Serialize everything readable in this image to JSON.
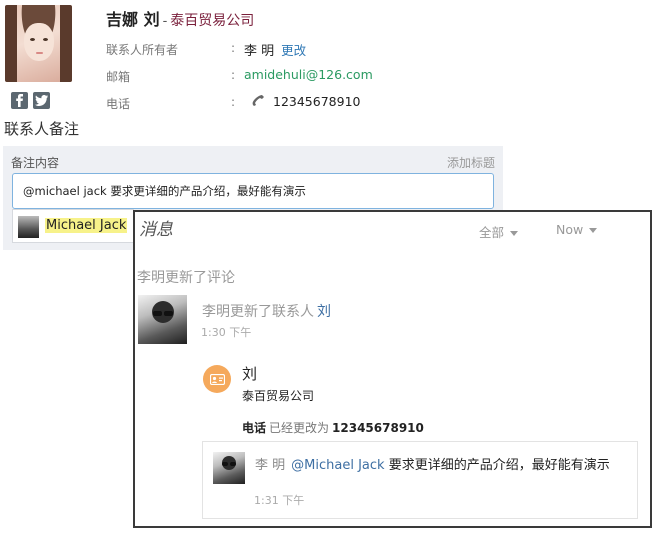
{
  "contact": {
    "name": "吉娜 刘",
    "separator": "-",
    "company": "泰百贸易公司",
    "avatar_icon": "user-photo",
    "social_icons": [
      "facebook-icon",
      "twitter-icon"
    ],
    "fields": {
      "owner_label": "联系人所有者",
      "owner_value": "李 明",
      "owner_change": "更改",
      "email_label": "邮箱",
      "email_value": "amidehuli@126.com",
      "phone_label": "电话",
      "phone_value": "12345678910",
      "colon": ":"
    }
  },
  "notes": {
    "section_title": "联系人备注",
    "content_label": "备注内容",
    "add_title": "添加标题",
    "input_value": "@michael jack 要求更详细的产品介绍，最好能有演示",
    "mention_suggestion": "Michael Jack"
  },
  "messages": {
    "title": "消息",
    "filter_all": "全部",
    "filter_time": "Now",
    "update_label": "李明更新了评论",
    "activity": {
      "text": "李明更新了联系人",
      "link": "刘",
      "time": "1:30 下午"
    },
    "card": {
      "name": "刘",
      "company": "泰百贸易公司",
      "phone_label": "电话",
      "phone_change": "已经更改为",
      "phone_value": "12345678910"
    },
    "comment": {
      "author": "李 明",
      "mention": "@Michael Jack",
      "text": "要求更详细的产品介绍，最好能有演示",
      "time": "1:31 下午"
    }
  },
  "colors": {
    "company": "#7a1f3b",
    "link": "#2f78b5",
    "email": "#2b9a62",
    "contact_badge": "#f5a95c",
    "mention_highlight": "#f7f28a"
  }
}
